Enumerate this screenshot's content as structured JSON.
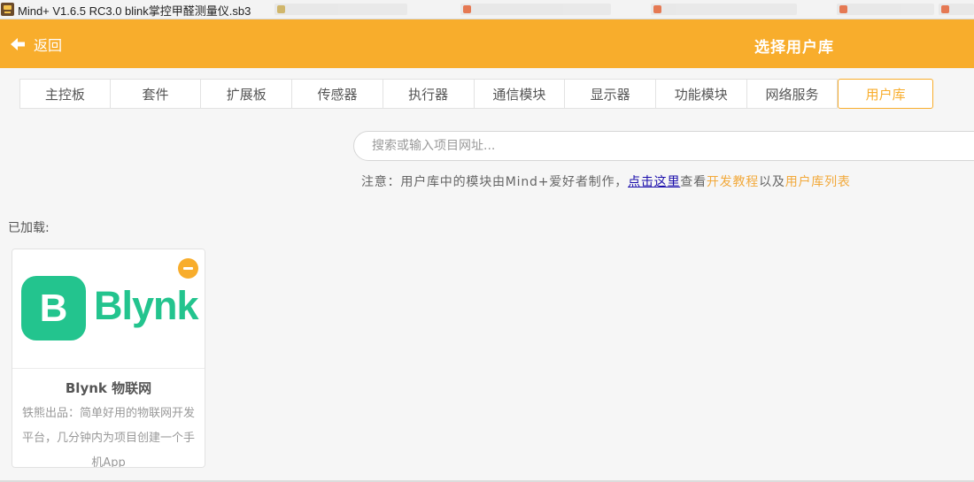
{
  "window": {
    "title": "Mind+ V1.6.5 RC3.0   blink掌控甲醛测量仪.sb3"
  },
  "header": {
    "back_label": "返回",
    "page_title": "选择用户库"
  },
  "tabs": [
    {
      "label": "主控板",
      "active": false
    },
    {
      "label": "套件",
      "active": false
    },
    {
      "label": "扩展板",
      "active": false
    },
    {
      "label": "传感器",
      "active": false
    },
    {
      "label": "执行器",
      "active": false
    },
    {
      "label": "通信模块",
      "active": false
    },
    {
      "label": "显示器",
      "active": false
    },
    {
      "label": "功能模块",
      "active": false
    },
    {
      "label": "网络服务",
      "active": false
    },
    {
      "label": "用户库",
      "active": true
    }
  ],
  "search": {
    "placeholder": "搜索或输入项目网址...",
    "value": ""
  },
  "notice": {
    "prefix": "注意：用户库中的模块由Mind+爱好者制作，",
    "link_click_here": "点击这里",
    "middle": "查看",
    "link_dev_tutorial": "开发教程",
    "and": "以及",
    "link_user_lib_list": "用户库列表"
  },
  "loaded": {
    "label": "已加载:",
    "cards": [
      {
        "logo_letter": "B",
        "logo_word": "Blynk",
        "title": "Blynk 物联网",
        "description": "铁熊出品：简单好用的物联网开发平台，几分钟内为项目创建一个手机App"
      }
    ]
  },
  "colors": {
    "accent": "#f8ad2c",
    "link_blue": "#1a0dab",
    "blynk_green": "#23c48e"
  },
  "icons": {
    "back": "arrow-left-icon",
    "remove": "minus-circle-icon",
    "app": "mind-plus-app-icon"
  }
}
